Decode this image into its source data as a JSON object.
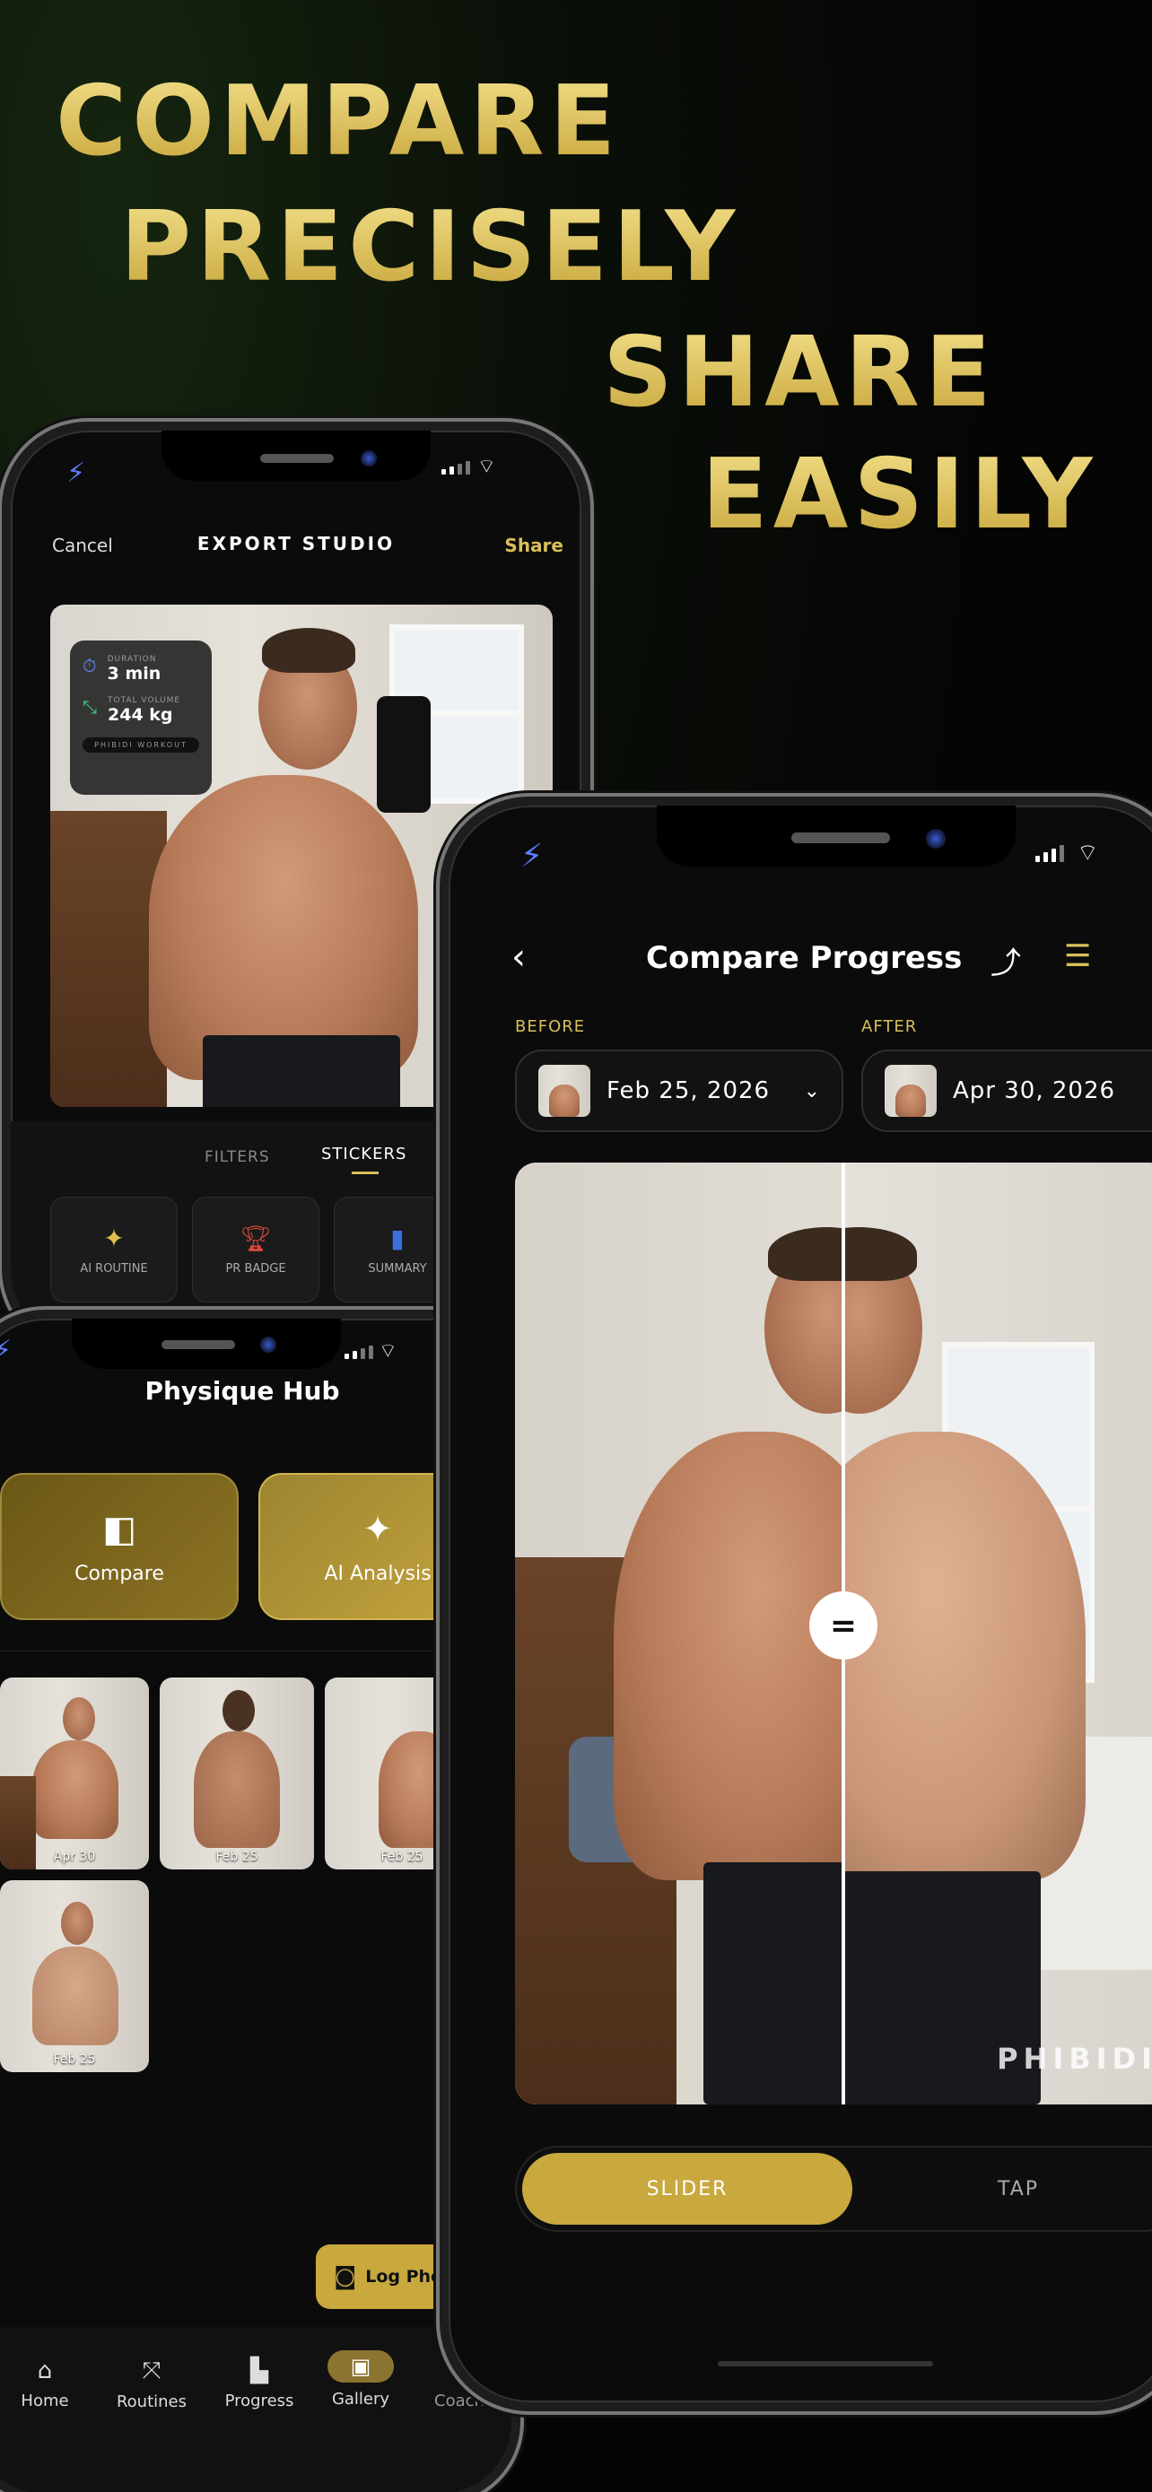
{
  "headlines": [
    "COMPARE",
    "PRECISELY",
    "SHARE",
    "EASILY"
  ],
  "colors": {
    "gold": "#d9bf5b",
    "gold_button": "#c9a83e",
    "background": "#050505",
    "accent_blue": "#5b7cff"
  },
  "export_studio": {
    "cancel": "Cancel",
    "title": "EXPORT STUDIO",
    "share": "Share",
    "sticker": {
      "duration_label": "DURATION",
      "duration_value": "3 min",
      "volume_label": "TOTAL VOLUME",
      "volume_value": "244 kg",
      "brand": "PHIBIDI WORKOUT"
    },
    "tabs": [
      "FILTERS",
      "STICKERS"
    ],
    "active_tab": "STICKERS",
    "sticker_options": [
      {
        "icon": "sparkles-icon",
        "label": "AI ROUTINE"
      },
      {
        "icon": "trophy-icon",
        "label": "PR BADGE"
      },
      {
        "icon": "chart-icon",
        "label": "SUMMARY"
      }
    ]
  },
  "physique_hub": {
    "title": "Physique Hub",
    "actions": [
      {
        "icon": "compare-icon",
        "label": "Compare"
      },
      {
        "icon": "sparkles-icon",
        "label": "AI Analysis"
      }
    ],
    "photos": [
      "Apr 30",
      "Feb 25",
      "Feb 25",
      "Feb 25"
    ],
    "log_photo": "Log Photo"
  },
  "bottom_nav": [
    {
      "icon": "home-icon",
      "label": "Home"
    },
    {
      "icon": "routines-icon",
      "label": "Routines"
    },
    {
      "icon": "progress-icon",
      "label": "Progress"
    },
    {
      "icon": "gallery-icon",
      "label": "Gallery",
      "active": true
    },
    {
      "icon": "coach-icon",
      "label": "Coach"
    }
  ],
  "compare": {
    "title": "Compare Progress",
    "before_label": "BEFORE",
    "after_label": "AFTER",
    "before_date": "Feb 25, 2026",
    "after_date": "Apr 30, 2026",
    "watermark": "PHIBIDI",
    "modes": [
      "SLIDER",
      "TAP"
    ],
    "active_mode": "SLIDER"
  }
}
